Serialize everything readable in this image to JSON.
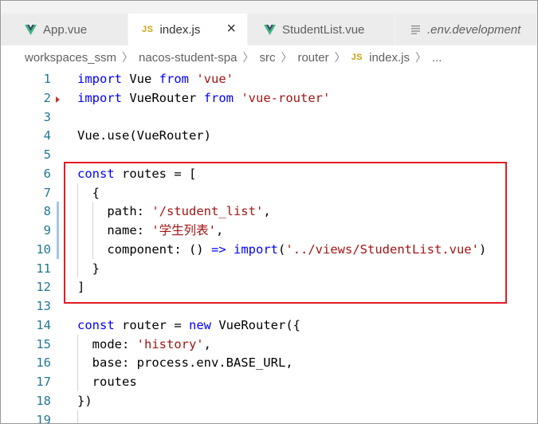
{
  "tabs": [
    {
      "label": "App.vue",
      "icon": "vue-icon",
      "active": false
    },
    {
      "label": "index.js",
      "icon": "js-icon",
      "icon_text": "JS",
      "active": true,
      "close": "×"
    },
    {
      "label": "StudentList.vue",
      "icon": "vue-icon",
      "active": false
    },
    {
      "label": ".env.development",
      "icon": "file-lines-icon",
      "active": false
    }
  ],
  "breadcrumb": {
    "items": [
      "workspaces_ssm",
      "nacos-student-spa",
      "src",
      "router"
    ],
    "file_icon_text": "JS",
    "file": "index.js",
    "ellipsis": "..."
  },
  "colors": {
    "keyword": "#0000ff",
    "string": "#a31515",
    "line_number": "#237893",
    "highlight_border": "#e31b23"
  },
  "code_lines": [
    {
      "n": "1",
      "text": "import Vue from 'vue'"
    },
    {
      "n": "2",
      "text": "import VueRouter from 'vue-router'"
    },
    {
      "n": "3",
      "text": ""
    },
    {
      "n": "4",
      "text": "Vue.use(VueRouter)"
    },
    {
      "n": "5",
      "text": ""
    },
    {
      "n": "6",
      "text": "const routes = ["
    },
    {
      "n": "7",
      "text": "  {"
    },
    {
      "n": "8",
      "text": "    path: '/student_list',"
    },
    {
      "n": "9",
      "text": "    name: '学生列表',"
    },
    {
      "n": "10",
      "text": "    component: () => import('../views/StudentList.vue')"
    },
    {
      "n": "11",
      "text": "  }"
    },
    {
      "n": "12",
      "text": "]"
    },
    {
      "n": "13",
      "text": ""
    },
    {
      "n": "14",
      "text": "const router = new VueRouter({"
    },
    {
      "n": "15",
      "text": "  mode: 'history',"
    },
    {
      "n": "16",
      "text": "  base: process.env.BASE_URL,"
    },
    {
      "n": "17",
      "text": "  routes"
    },
    {
      "n": "18",
      "text": "})"
    },
    {
      "n": "19",
      "text": ""
    }
  ]
}
